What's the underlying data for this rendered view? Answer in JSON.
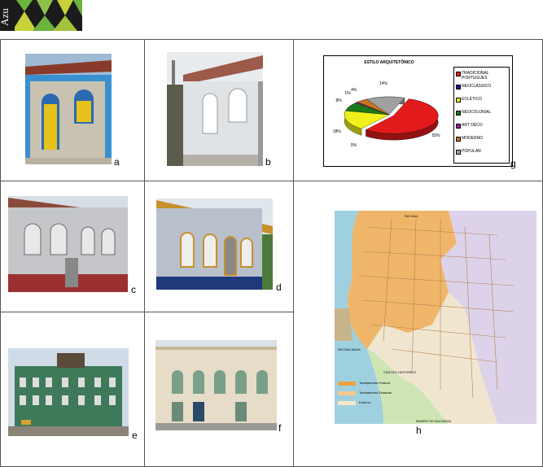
{
  "logo": {
    "text": "Azu"
  },
  "photos": {
    "a": {
      "letter": "a"
    },
    "b": {
      "letter": "b"
    },
    "c": {
      "letter": "c"
    },
    "d": {
      "letter": "d"
    },
    "e": {
      "letter": "e"
    },
    "f": {
      "letter": "f"
    },
    "g": {
      "letter": "g"
    },
    "h": {
      "letter": "h"
    }
  },
  "chart_data": {
    "type": "pie",
    "title": "ESTILO ARQUITETÔNICO",
    "categories": [
      "TRADICIONAL PORTUGUES",
      "NEOCLÁSSICO",
      "ECLÉTICO",
      "NEOCOLONIAL",
      "ART DÉCO",
      "MODERNO",
      "POPULAR"
    ],
    "values": [
      55,
      0,
      18,
      8,
      1,
      4,
      14
    ],
    "labels": [
      "55%",
      "0%",
      "18%",
      "8%",
      "1%",
      "4%",
      "14%"
    ],
    "colors": [
      "#e31a1c",
      "#1a1a8c",
      "#f0f01a",
      "#1a7a1a",
      "#9b1a9b",
      "#c8781a",
      "#a0a0a0"
    ],
    "legend_position": "right"
  },
  "map": {
    "labels": {
      "north": "RIO ANIL",
      "west": "RIO BACANGA",
      "south": "BAIRRO DO BACANGA",
      "center": "CENTRO HISTÓRICO"
    },
    "legend_lines": [
      "Tombamento Federal",
      "Tombamento Estadual",
      "Entorno"
    ]
  }
}
